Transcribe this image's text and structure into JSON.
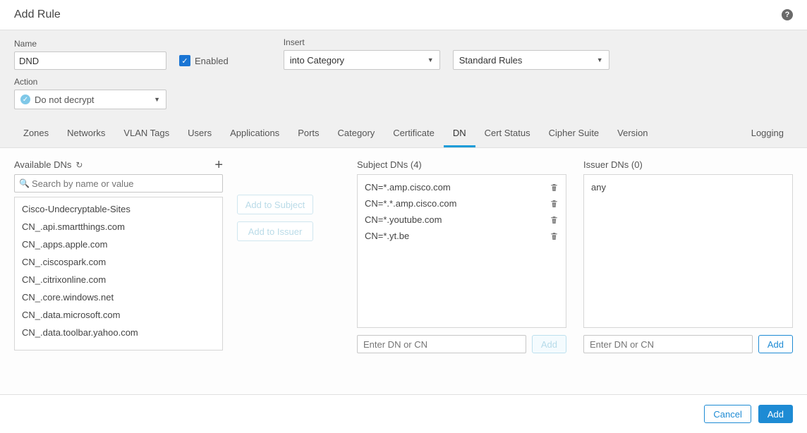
{
  "dialog": {
    "title": "Add Rule"
  },
  "fields": {
    "name_label": "Name",
    "name_value": "DND",
    "enabled_label": "Enabled",
    "enabled_checked": true,
    "insert_label": "Insert",
    "insert_select_value": "into Category",
    "rules_select_value": "Standard Rules",
    "action_label": "Action",
    "action_value": "Do not decrypt"
  },
  "tabs": [
    {
      "id": "zones",
      "label": "Zones"
    },
    {
      "id": "networks",
      "label": "Networks"
    },
    {
      "id": "vlan",
      "label": "VLAN Tags"
    },
    {
      "id": "users",
      "label": "Users"
    },
    {
      "id": "applications",
      "label": "Applications"
    },
    {
      "id": "ports",
      "label": "Ports"
    },
    {
      "id": "category",
      "label": "Category"
    },
    {
      "id": "certificate",
      "label": "Certificate"
    },
    {
      "id": "dn",
      "label": "DN",
      "active": true
    },
    {
      "id": "certstatus",
      "label": "Cert Status"
    },
    {
      "id": "cipher",
      "label": "Cipher Suite"
    },
    {
      "id": "version",
      "label": "Version"
    },
    {
      "id": "logging",
      "label": "Logging",
      "align_right": true
    }
  ],
  "available": {
    "title": "Available DNs",
    "search_placeholder": "Search by name or value",
    "items": [
      "Cisco-Undecryptable-Sites",
      "CN_.api.smartthings.com",
      "CN_.apps.apple.com",
      "CN_.ciscospark.com",
      "CN_.citrixonline.com",
      "CN_.core.windows.net",
      "CN_.data.microsoft.com",
      "CN_.data.toolbar.yahoo.com"
    ]
  },
  "mid_buttons": {
    "add_subject": "Add to Subject",
    "add_issuer": "Add to Issuer"
  },
  "subject": {
    "title": "Subject DNs (4)",
    "items": [
      "CN=*.amp.cisco.com",
      "CN=*.*.amp.cisco.com",
      "CN=*.youtube.com",
      "CN=*.yt.be"
    ],
    "input_placeholder": "Enter DN or CN",
    "add_label": "Add"
  },
  "issuer": {
    "title": "Issuer DNs (0)",
    "any_label": "any",
    "input_placeholder": "Enter DN or CN",
    "add_label": "Add"
  },
  "footer": {
    "cancel": "Cancel",
    "add": "Add"
  }
}
